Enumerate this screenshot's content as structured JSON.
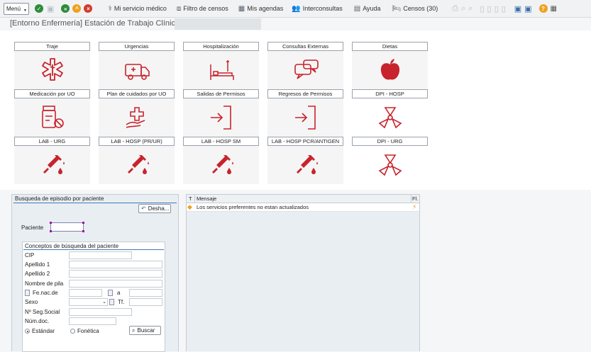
{
  "toolbar": {
    "menu_label": "Menú",
    "items": [
      {
        "label": "Mi servicio médico",
        "icon": "stethoscope-icon"
      },
      {
        "label": "Filtro de censos",
        "icon": "filter-icon"
      },
      {
        "label": "Mis agendas",
        "icon": "calendar-icon"
      },
      {
        "label": "Interconsultas",
        "icon": "people-icon"
      },
      {
        "label": "Ayuda",
        "icon": "book-icon"
      },
      {
        "label": "Censos (30)",
        "icon": "bed-icon"
      }
    ],
    "colors": {
      "green": "#2e8b3a",
      "orange": "#f0a020",
      "red": "#d33a2c",
      "help": "#f0a020"
    }
  },
  "title": "[Entorno Enfermería] Estación de Trabajo Clínico -",
  "tiles": [
    {
      "label": "Traje",
      "icon": "medical-star-icon"
    },
    {
      "label": "Urgencias",
      "icon": "ambulance-icon"
    },
    {
      "label": "Hospitalización",
      "icon": "hospital-bed-icon"
    },
    {
      "label": "Consultas Externas",
      "icon": "chat-bubbles-icon"
    },
    {
      "label": "Dietas",
      "icon": "apple-icon"
    },
    {
      "label": "Medicación por UO",
      "icon": "pill-bottle-icon"
    },
    {
      "label": "Plan de cuidados por UO",
      "icon": "care-hands-icon"
    },
    {
      "label": "Salidas de Permisos",
      "icon": "exit-door-icon"
    },
    {
      "label": "Regresos de Permisos",
      "icon": "enter-door-icon"
    },
    {
      "label": "DPI - HOSP",
      "icon": "dpi-icon"
    },
    {
      "label": "LAB - URG",
      "icon": "syringe-icon"
    },
    {
      "label": "LAB - HOSP (PR/UR)",
      "icon": "syringe-icon"
    },
    {
      "label": "LAB - HOSP SM",
      "icon": "syringe-icon"
    },
    {
      "label": "LAB - HOSP PCR/ANTIGEN",
      "icon": "syringe-icon"
    },
    {
      "label": "DPI - URG",
      "icon": "dpi-icon"
    }
  ],
  "search": {
    "title": "Busqueda de episodio por paciente",
    "undo_label": "Desha...",
    "paciente_label": "Paciente",
    "concepts_title": "Conceptos de búsqueda del paciente",
    "fields": {
      "cip": "CIP",
      "apellido1": "Apellido 1",
      "apellido2": "Apellido 2",
      "nombre": "Nombre de pila",
      "fenac": "Fe.nac.de",
      "a": "a",
      "sexo": "Sexo",
      "tf": "Tf.",
      "nss": "Nº Seg.Social",
      "numdoc": "Núm.doc."
    },
    "radio_estandar": "Estándar",
    "radio_fonetica": "Fonética",
    "search_button": "Buscar"
  },
  "messages": {
    "col_t": "T",
    "col_mensaje": "Mensaje",
    "col_fl": "Fl.",
    "rows": [
      {
        "text": "Los servicios preferentes no estan actualizados"
      }
    ]
  }
}
